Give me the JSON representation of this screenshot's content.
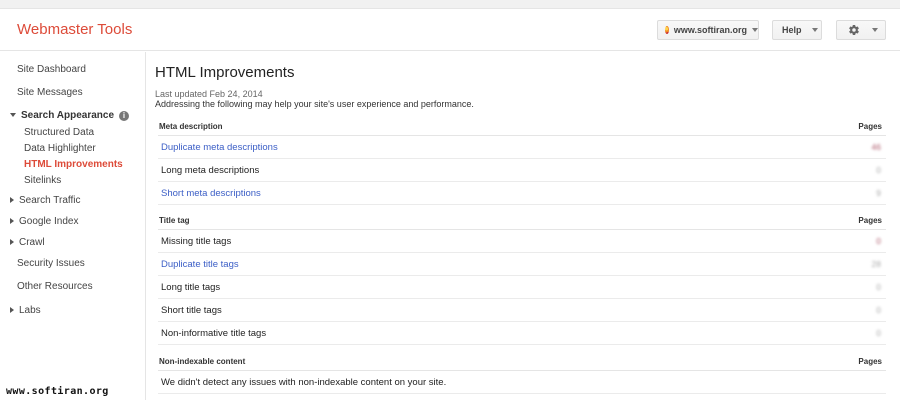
{
  "header": {
    "brand": "Webmaster Tools",
    "site": "www.softiran.org",
    "help_label": "Help",
    "gear_icon": "gear-icon"
  },
  "sidebar": {
    "items": [
      {
        "label": "Site Dashboard"
      },
      {
        "label": "Site Messages"
      },
      {
        "label": "Search Appearance"
      },
      {
        "label": "Structured Data"
      },
      {
        "label": "Data Highlighter"
      },
      {
        "label": "HTML Improvements"
      },
      {
        "label": "Sitelinks"
      },
      {
        "label": "Search Traffic"
      },
      {
        "label": "Google Index"
      },
      {
        "label": "Crawl"
      },
      {
        "label": "Security Issues"
      },
      {
        "label": "Other Resources"
      },
      {
        "label": "Labs"
      }
    ],
    "info_glyph": "i"
  },
  "main": {
    "title": "HTML Improvements",
    "updated": "Last updated Feb 24, 2014",
    "description": "Addressing the following may help your site's user experience and performance.",
    "pages_header": "Pages",
    "sections": [
      {
        "label": "Meta description",
        "rows": [
          {
            "text": "Duplicate meta descriptions",
            "count": "46"
          },
          {
            "text": "Long meta descriptions",
            "count": "0"
          },
          {
            "text": "Short meta descriptions",
            "count": "9"
          }
        ]
      },
      {
        "label": "Title tag",
        "rows": [
          {
            "text": "Missing title tags",
            "count": "0"
          },
          {
            "text": "Duplicate title tags",
            "count": "28"
          },
          {
            "text": "Long title tags",
            "count": "0"
          },
          {
            "text": "Short title tags",
            "count": "0"
          },
          {
            "text": "Non-informative title tags",
            "count": "0"
          }
        ]
      },
      {
        "label": "Non-indexable content",
        "message": "We didn't detect any issues with non-indexable content on your site."
      }
    ]
  },
  "watermark": "www.softiran.org",
  "colors": {
    "brand_red": "#dd4b39",
    "link_blue": "#3b5ec6"
  }
}
